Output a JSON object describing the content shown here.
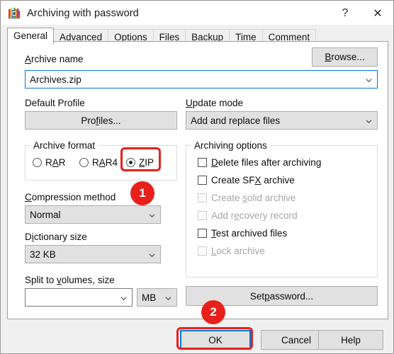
{
  "window": {
    "title": "Archiving with password",
    "icon": "winrar-books-icon",
    "help_button": "?",
    "close_button": "✕",
    "accent": "#0078d7",
    "annotation_color": "#e8201b"
  },
  "tabs": [
    {
      "label": "General",
      "active": true
    },
    {
      "label": "Advanced",
      "active": false
    },
    {
      "label": "Options",
      "active": false
    },
    {
      "label": "Files",
      "active": false
    },
    {
      "label": "Backup",
      "active": false
    },
    {
      "label": "Time",
      "active": false
    },
    {
      "label": "Comment",
      "active": false
    }
  ],
  "archive_name": {
    "label_pre": "A",
    "label_post": "rchive name",
    "value": "Archives.zip",
    "browse_button": {
      "pre": "B",
      "post": "rowse..."
    }
  },
  "profile": {
    "label": "Default Profile",
    "button": {
      "pre": "Pro",
      "mid": "f",
      "post": "iles..."
    }
  },
  "update_mode": {
    "label_pre": "U",
    "label_post": "pdate mode",
    "value": "Add and replace files"
  },
  "archive_format": {
    "group_title": "Archive format",
    "options": [
      {
        "pre": "R",
        "mid": "A",
        "post": "R",
        "selected": false,
        "name": "RAR"
      },
      {
        "pre": "R",
        "mid": "A",
        "post": "R4",
        "selected": false,
        "name": "RAR4"
      },
      {
        "pre": "",
        "mid": "Z",
        "post": "IP",
        "selected": true,
        "name": "ZIP"
      }
    ]
  },
  "compression_method": {
    "label_pre": "C",
    "label_post": "ompression method",
    "value": "Normal"
  },
  "dictionary_size": {
    "label_pre": "D",
    "label_mid": "i",
    "label_post": "ctionary size",
    "value": "32 KB"
  },
  "split_volumes": {
    "label_pre": "Split to ",
    "label_mid": "v",
    "label_post": "olumes, size",
    "value": "",
    "unit": "MB"
  },
  "archiving_options": {
    "group_title": "Archiving options",
    "items": [
      {
        "pre": "",
        "mid": "D",
        "post": "elete files after archiving",
        "checked": false,
        "enabled": true,
        "name": "delete-files-after-archiving"
      },
      {
        "pre": "Create SF",
        "mid": "X",
        "post": " archive",
        "checked": false,
        "enabled": true,
        "name": "create-sfx-archive"
      },
      {
        "pre": "Create ",
        "mid": "s",
        "post": "olid archive",
        "checked": false,
        "enabled": false,
        "name": "create-solid-archive"
      },
      {
        "pre": "Add r",
        "mid": "e",
        "post": "covery record",
        "checked": false,
        "enabled": false,
        "name": "add-recovery-record"
      },
      {
        "pre": "",
        "mid": "T",
        "post": "est archived files",
        "checked": false,
        "enabled": true,
        "name": "test-archived-files"
      },
      {
        "pre": "",
        "mid": "L",
        "post": "ock archive",
        "checked": false,
        "enabled": false,
        "name": "lock-archive"
      }
    ]
  },
  "set_password": {
    "pre": "Set ",
    "mid": "p",
    "post": "assword..."
  },
  "footer": {
    "ok": "OK",
    "cancel": "Cancel",
    "help": "Help"
  },
  "annotations": [
    {
      "badge": "1",
      "target": "zip-radio"
    },
    {
      "badge": "2",
      "target": "ok-button"
    }
  ]
}
